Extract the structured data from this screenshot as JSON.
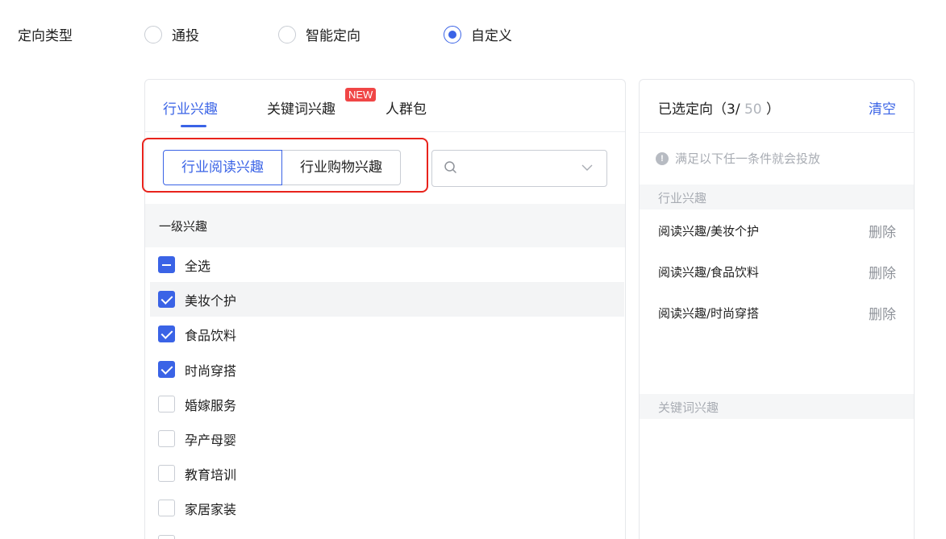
{
  "targeting": {
    "label": "定向类型",
    "options": [
      {
        "label": "通投",
        "checked": false
      },
      {
        "label": "智能定向",
        "checked": false
      },
      {
        "label": "自定义",
        "checked": true
      }
    ]
  },
  "left_panel": {
    "tabs": [
      {
        "label": "行业兴趣",
        "active": true
      },
      {
        "label": "关键词兴趣",
        "badge": "NEW",
        "active": false
      },
      {
        "label": "人群包",
        "active": false
      }
    ],
    "segments": [
      {
        "label": "行业阅读兴趣",
        "active": true
      },
      {
        "label": "行业购物兴趣",
        "active": false
      }
    ],
    "search": {
      "value": ""
    },
    "list_header": "一级兴趣",
    "items": [
      {
        "label": "全选",
        "state": "indeterminate"
      },
      {
        "label": "美妆个护",
        "state": "checked"
      },
      {
        "label": "食品饮料",
        "state": "checked"
      },
      {
        "label": "时尚穿搭",
        "state": "checked"
      },
      {
        "label": "婚嫁服务",
        "state": "unchecked"
      },
      {
        "label": "孕产母婴",
        "state": "unchecked"
      },
      {
        "label": "教育培训",
        "state": "unchecked"
      },
      {
        "label": "家居家装",
        "state": "unchecked"
      }
    ]
  },
  "right_panel": {
    "title_prefix": "已选定向（3/",
    "title_max": " 50",
    "title_suffix": " ）",
    "clear_label": "清空",
    "notice_icon": "!",
    "notice": "满足以下任一条件就会投放",
    "section_industry": "行业兴趣",
    "selected": [
      {
        "name": "阅读兴趣/美妆个护",
        "action": "删除"
      },
      {
        "name": "阅读兴趣/食品饮料",
        "action": "删除"
      },
      {
        "name": "阅读兴趣/时尚穿搭",
        "action": "删除"
      }
    ],
    "section_keyword": "关键词兴趣"
  },
  "colors": {
    "accent": "#3a63e6",
    "highlight_box": "#e8231c",
    "badge": "#f04646"
  }
}
